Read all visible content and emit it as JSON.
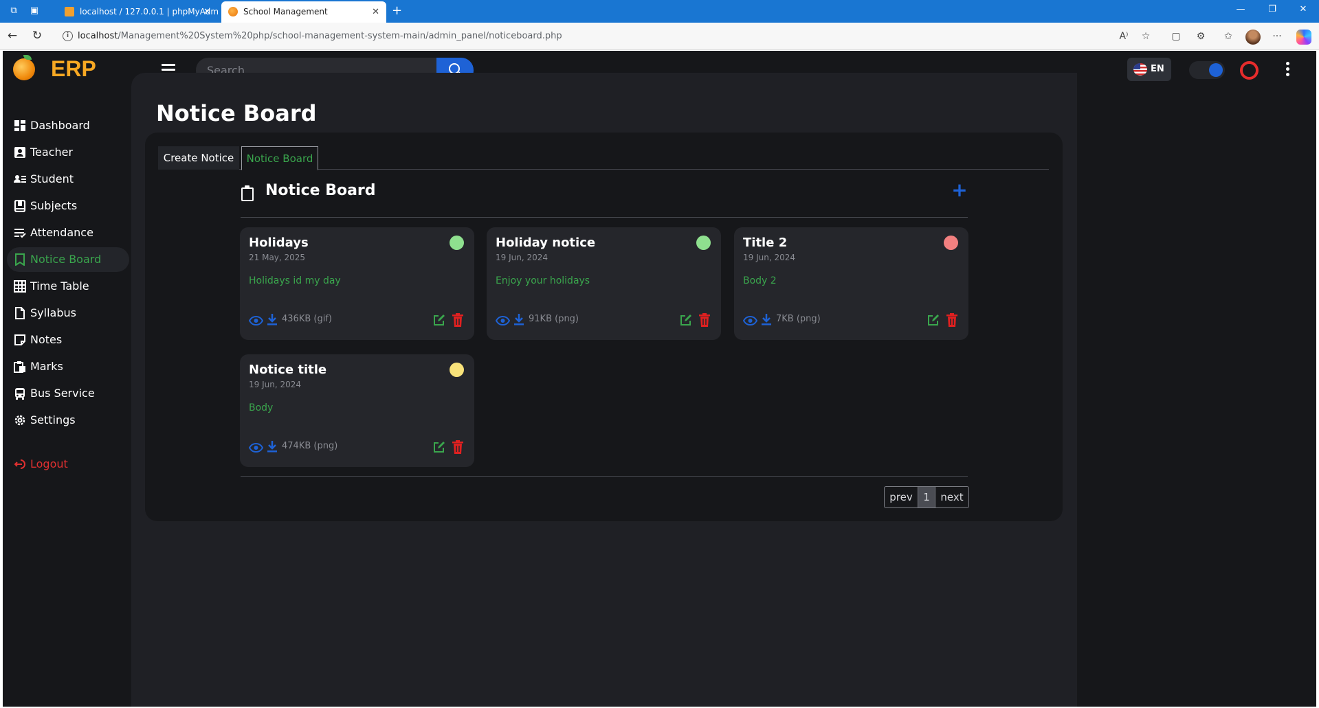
{
  "browser": {
    "tabs": [
      {
        "title": "localhost / 127.0.0.1 | phpMyAdmin",
        "active": false
      },
      {
        "title": "School Management",
        "active": true
      }
    ],
    "url_host": "localhost",
    "url_path": "/Management%20System%20php/school-management-system-main/admin_panel/noticeboard.php"
  },
  "app": {
    "brand": "ERP",
    "search_placeholder": "Search...",
    "language": "EN",
    "accent_color": "#3aa64d",
    "primary_color": "#1e62d6"
  },
  "sidebar": {
    "items": [
      {
        "label": "Dashboard",
        "icon": "dashboard-icon"
      },
      {
        "label": "Teacher",
        "icon": "teacher-icon"
      },
      {
        "label": "Student",
        "icon": "student-icon"
      },
      {
        "label": "Subjects",
        "icon": "book-icon"
      },
      {
        "label": "Attendance",
        "icon": "checklist-icon"
      },
      {
        "label": "Notice Board",
        "icon": "bookmark-icon",
        "active": true
      },
      {
        "label": "Time Table",
        "icon": "table-icon"
      },
      {
        "label": "Syllabus",
        "icon": "file-icon"
      },
      {
        "label": "Notes",
        "icon": "note-icon"
      },
      {
        "label": "Marks",
        "icon": "clipboard-icon"
      },
      {
        "label": "Bus Service",
        "icon": "bus-icon"
      },
      {
        "label": "Settings",
        "icon": "gear-icon"
      }
    ],
    "logout": "Logout"
  },
  "page": {
    "title": "Notice Board",
    "tabs": [
      "Create Notice",
      "Notice Board"
    ],
    "section_title": "Notice Board"
  },
  "notices": [
    {
      "title": "Holidays",
      "date": "21 May, 2025",
      "body": "Holidays id my day",
      "size": "436KB (gif)",
      "status_color": "#8fe08f"
    },
    {
      "title": "Holiday notice",
      "date": "19 Jun, 2024",
      "body": "Enjoy your holidays",
      "size": "91KB (png)",
      "status_color": "#8fe08f"
    },
    {
      "title": "Title 2",
      "date": "19 Jun, 2024",
      "body": "Body 2",
      "size": "7KB (png)",
      "status_color": "#f28080"
    },
    {
      "title": "Notice title",
      "date": "19 Jun, 2024",
      "body": "Body",
      "size": "474KB (png)",
      "status_color": "#f8e27a"
    }
  ],
  "pagination": {
    "prev": "prev",
    "current": "1",
    "next": "next"
  }
}
